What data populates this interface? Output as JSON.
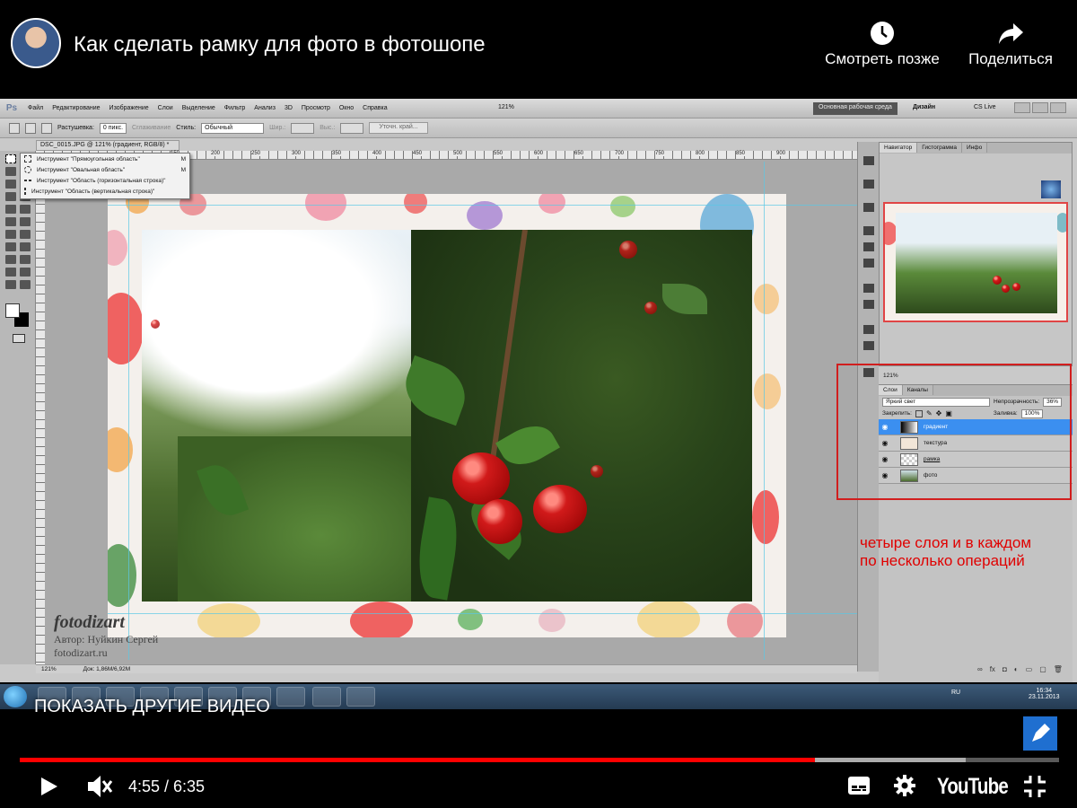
{
  "video": {
    "title": "Как сделать рамку для фото в фотошопе",
    "watch_later": "Смотреть позже",
    "share": "Поделиться",
    "more_videos": "ПОКАЗАТЬ ДРУГИЕ ВИДЕО",
    "time": "4:55 / 6:35",
    "progress": 0.765,
    "buffered": 0.91,
    "logo": "YouTube"
  },
  "photoshop": {
    "logo": "Ps",
    "menu": [
      "Файл",
      "Редактирование",
      "Изображение",
      "Слои",
      "Выделение",
      "Фильтр",
      "Анализ",
      "3D",
      "Просмотр",
      "Окно",
      "Справка"
    ],
    "zoom_top": "121%",
    "workspace": "Основная рабочая среда",
    "design": "Дизайн",
    "cs_live": "CS Live",
    "options": {
      "feather_label": "Растушевка:",
      "feather_value": "0 пикс.",
      "antialias": "Сглаживание",
      "style_label": "Стиль:",
      "style_value": "Обычный",
      "width_label": "Шир.:",
      "height_label": "Выс.:",
      "refine_edge": "Уточн. край..."
    },
    "doc_tab": "DSC_0015.JPG @ 121% (градиент, RGB/8) *",
    "flyout": [
      {
        "label": "Инструмент \"Прямоугольная область\"",
        "key": "M"
      },
      {
        "label": "Инструмент \"Овальная область\"",
        "key": "M"
      },
      {
        "label": "Инструмент \"Область (горизонтальная строка)\"",
        "key": ""
      },
      {
        "label": "Инструмент \"Область (вертикальная строка)\"",
        "key": ""
      }
    ],
    "ruler_ticks": [
      "150",
      "200",
      "250",
      "300",
      "350",
      "400",
      "450",
      "500",
      "550",
      "600",
      "650",
      "700",
      "750",
      "800",
      "850",
      "900"
    ],
    "watermark": {
      "logo": "fotodizart",
      "author": "Автор: Нуйкин Сергей",
      "site": "fotodizart.ru"
    },
    "status": {
      "zoom": "121%",
      "doc": "Док: 1,86M/6,92M"
    },
    "navigator": {
      "tabs": [
        "Навигатор",
        "Гистограмма",
        "Инфо"
      ],
      "zoom": "121%"
    },
    "layers": {
      "tabs": [
        "Слои",
        "Каналы"
      ],
      "blend_mode": "Яркий свет",
      "opacity_label": "Непрозрачность:",
      "opacity_value": "36%",
      "lock_label": "Закрепить:",
      "fill_label": "Заливка:",
      "fill_value": "100%",
      "items": [
        {
          "name": "градиент",
          "active": true
        },
        {
          "name": "текстура",
          "active": false
        },
        {
          "name": "рамка",
          "active": false
        },
        {
          "name": "фото",
          "active": false
        }
      ]
    }
  },
  "annotation": {
    "line1": "четыре  слоя и в каждом",
    "line2": "по несколько операций"
  },
  "taskbar": {
    "lang": "RU",
    "time": "16:34",
    "date": "23.11.2013"
  }
}
